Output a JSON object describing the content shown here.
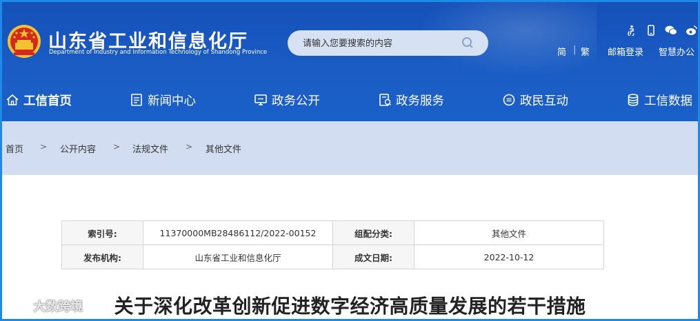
{
  "header": {
    "title": "山东省工业和信息化厅",
    "subtitle": "Department of Industry and Information Technology of Shandong Province",
    "search_placeholder": "请输入您要搜索的内容",
    "icons": [
      "accessibility-icon",
      "mobile-icon",
      "wechat-icon",
      "weibo-icon"
    ],
    "links": {
      "simplified": "简",
      "traditional": "繁",
      "mailbox_login": "邮箱登录",
      "smart_office": "智慧办公",
      "separator": "|"
    }
  },
  "nav": {
    "items": [
      {
        "label": "工信首页",
        "icon": "home-icon"
      },
      {
        "label": "新闻中心",
        "icon": "news-icon"
      },
      {
        "label": "政务公开",
        "icon": "monitor-icon"
      },
      {
        "label": "政务服务",
        "icon": "service-icon"
      },
      {
        "label": "政民互动",
        "icon": "chat-icon"
      },
      {
        "label": "工信数据",
        "icon": "database-icon"
      }
    ]
  },
  "breadcrumb": {
    "items": [
      "首页",
      "公开内容",
      "法规文件",
      "其他文件"
    ],
    "separator": ">"
  },
  "meta": {
    "index_label": "索引号:",
    "index_value": "11370000MB28486112/2022-00152",
    "category_label": "组配分类:",
    "category_value": "其他文件",
    "publisher_label": "发布机构:",
    "publisher_value": "山东省工业和信息化厅",
    "date_label": "成文日期:",
    "date_value": "2022-10-12"
  },
  "article": {
    "title": "关于深化改革创新促进数字经济高质量发展的若干措施"
  },
  "watermark": "大数跨境",
  "colors": {
    "header_blue": "#1a5cc4",
    "breadcrumb_bg": "#d3ddf1",
    "frame_blue": "#1c8ae6"
  }
}
